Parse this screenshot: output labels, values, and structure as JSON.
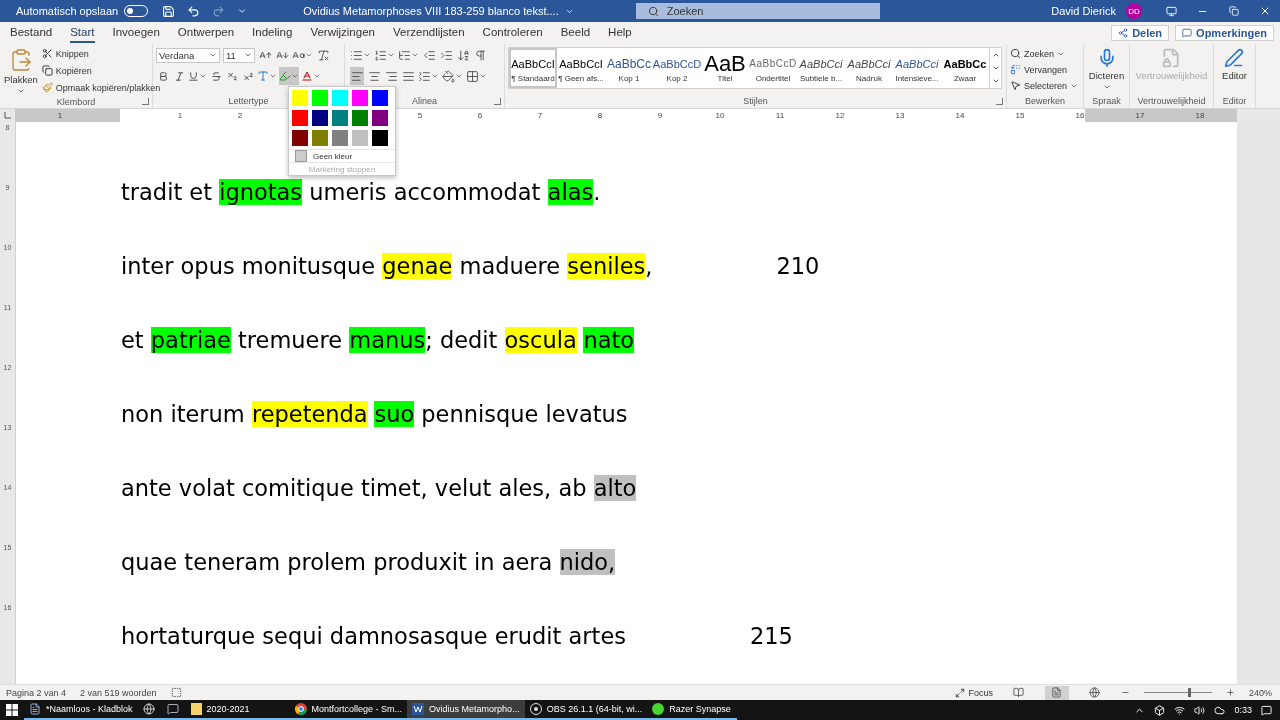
{
  "title_bar": {
    "autosave_label": "Automatisch opslaan",
    "autosave_on": false,
    "title": "Ovidius Metamorphoses VIII 183-259 blanco tekst....",
    "search_placeholder": "Zoeken",
    "user_name": "David Dierick",
    "user_initials": "DD"
  },
  "tabs": [
    {
      "label": "Bestand",
      "selected": false
    },
    {
      "label": "Start",
      "selected": true
    },
    {
      "label": "Invoegen",
      "selected": false
    },
    {
      "label": "Ontwerpen",
      "selected": false
    },
    {
      "label": "Indeling",
      "selected": false
    },
    {
      "label": "Verwijzingen",
      "selected": false
    },
    {
      "label": "Verzendlijsten",
      "selected": false
    },
    {
      "label": "Controleren",
      "selected": false
    },
    {
      "label": "Beeld",
      "selected": false
    },
    {
      "label": "Help",
      "selected": false
    }
  ],
  "share_button": "Delen",
  "comments_button": "Opmerkingen",
  "ribbon": {
    "clipboard": {
      "label": "Klembord",
      "paste": "Plakken",
      "cut": "Knippen",
      "copy": "Kopiëren",
      "format_painter": "Opmaak kopiëren/plakken"
    },
    "font": {
      "label": "Lettertype",
      "family": "Verdana",
      "size": "11"
    },
    "paragraph": {
      "label": "Alinea"
    },
    "styles": {
      "label": "Stijlen",
      "items": [
        {
          "preview": "AaBbCcI",
          "name": "¶ Standaard",
          "kind": "normal",
          "selected": true
        },
        {
          "preview": "AaBbCcI",
          "name": "¶ Geen afs...",
          "kind": "normal",
          "selected": false
        },
        {
          "preview": "AaBbCc",
          "name": "Kop 1",
          "kind": "heading",
          "selected": false
        },
        {
          "preview": "AaBbCcD",
          "name": "Kop 2",
          "kind": "heading2",
          "selected": false
        },
        {
          "preview": "AaB",
          "name": "Titel",
          "kind": "title",
          "selected": false
        },
        {
          "preview": "AaBbCcD",
          "name": "Ondertitel",
          "kind": "subtitle",
          "selected": false
        },
        {
          "preview": "AaBbCci",
          "name": "Subtiele b...",
          "kind": "emphasis",
          "selected": false
        },
        {
          "preview": "AaBbCci",
          "name": "Nadruk",
          "kind": "emphasis",
          "selected": false
        },
        {
          "preview": "AaBbCci",
          "name": "Intensieve...",
          "kind": "intense",
          "selected": false
        },
        {
          "preview": "AaBbCc",
          "name": "Zwaar",
          "kind": "strong",
          "selected": false
        }
      ]
    },
    "editing": {
      "label": "Bewerken",
      "find": "Zoeken",
      "replace": "Vervangen",
      "select": "Selecteren"
    },
    "voice": {
      "label": "Spraak",
      "dictate": "Dicteren"
    },
    "sensitivity": {
      "label": "Vertrouwelijkheid",
      "button": "Vertrouwelijkheid",
      "disabled": true
    },
    "editor": {
      "label": "Editor",
      "button": "Editor"
    }
  },
  "highlight_menu": {
    "colors": [
      {
        "color": "#ffff00"
      },
      {
        "color": "#00ff00"
      },
      {
        "color": "#00ffff"
      },
      {
        "color": "#ff00ff"
      },
      {
        "color": "#0000ff"
      },
      {
        "color": "#ff0000"
      },
      {
        "color": "#000080"
      },
      {
        "color": "#008080"
      },
      {
        "color": "#008000"
      },
      {
        "color": "#800080"
      },
      {
        "color": "#800000"
      },
      {
        "color": "#808000"
      },
      {
        "color": "#808080"
      },
      {
        "color": "#c0c0c0"
      },
      {
        "color": "#000000"
      }
    ],
    "no_color": "Geen kleur",
    "stop": "Markering stoppen",
    "stop_disabled": true
  },
  "ruler": {
    "segments": [
      [
        "1"
      ],
      [
        "1",
        "2"
      ],
      [
        "5",
        "6",
        "7",
        "8",
        "9",
        "10",
        "11",
        "12",
        "13",
        "14",
        "15",
        "16",
        "17",
        "18"
      ]
    ]
  },
  "vertical_ruler": [
    "8",
    "9",
    "10",
    "11",
    "12",
    "13",
    "14",
    "15",
    "16"
  ],
  "document": {
    "lines": [
      {
        "segments": [
          {
            "text": "tradit et "
          },
          {
            "text": "ignotas",
            "color": "#00ff00"
          },
          {
            "text": " umeris accommodat "
          },
          {
            "text": "alas",
            "color": "#00ff00"
          },
          {
            "text": "."
          }
        ]
      },
      {
        "segments": [
          {
            "text": "inter opus monitusque "
          },
          {
            "text": "genae",
            "color": "#ffff00"
          },
          {
            "text": " maduere "
          },
          {
            "text": "seniles",
            "color": "#ffff00"
          },
          {
            "text": ","
          }
        ],
        "line_number": "210"
      },
      {
        "segments": [
          {
            "text": "et "
          },
          {
            "text": "patriae",
            "color": "#00ff00"
          },
          {
            "text": " tremuere "
          },
          {
            "text": "manus",
            "color": "#00ff00"
          },
          {
            "text": "; dedit "
          },
          {
            "text": "oscula",
            "color": "#ffff00"
          },
          {
            "text": "nato",
            "color": "#00ff00"
          }
        ]
      },
      {
        "segments": [
          {
            "text": "non iterum "
          },
          {
            "text": "repetenda",
            "color": "#ffff00"
          },
          {
            "text": "suo",
            "color": "#00ff00"
          },
          {
            "text": " pennisque levatus"
          }
        ]
      },
      {
        "segments": [
          {
            "text": "ante volat comitique timet, velut ales, ab "
          },
          {
            "text": "alto",
            "color": "#c0c0c0"
          }
        ]
      },
      {
        "segments": [
          {
            "text": "quae teneram prolem produxit in aera "
          },
          {
            "text": "nido,",
            "color": "#c0c0c0"
          }
        ]
      },
      {
        "segments": [
          {
            "text": "hortaturque sequi damnosasque erudit artes"
          }
        ],
        "line_number": "215"
      }
    ]
  },
  "status_bar": {
    "page": "Pagina 2 van 4",
    "words": "2 van 519 woorden",
    "focus": "Focus",
    "zoom": "240%",
    "level": 0.66
  },
  "taskbar": {
    "items": [
      {
        "kind": "notepad",
        "label": "*Naamloos - Kladblok",
        "selected": false
      },
      {
        "kind": "steam",
        "selected": false
      },
      {
        "kind": "discord",
        "selected": false
      },
      {
        "kind": "folder",
        "label": "2020-2021",
        "selected": false
      },
      {
        "kind": "chrome",
        "label": "Montfortcollege - Sm...",
        "selected": false
      },
      {
        "kind": "word",
        "label": "Ovidius Metamorpho...",
        "selected": true
      },
      {
        "kind": "obs",
        "label": "OBS 26.1.1 (64-bit, wi...",
        "selected": false
      },
      {
        "kind": "razer",
        "label": "Razer Synapse",
        "selected": false
      }
    ],
    "time": "0:33"
  }
}
